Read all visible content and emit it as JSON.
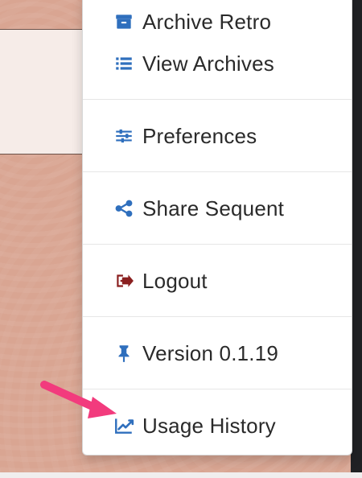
{
  "menu": {
    "items": [
      {
        "label": "Archive Retro",
        "icon": "archive-box-icon",
        "color": "#2f6fbd"
      },
      {
        "label": "View Archives",
        "icon": "list-icon",
        "color": "#2f6fbd"
      },
      {
        "label": "Preferences",
        "icon": "sliders-icon",
        "color": "#2f6fbd"
      },
      {
        "label": "Share Sequent",
        "icon": "share-nodes-icon",
        "color": "#2f6fbd"
      },
      {
        "label": "Logout",
        "icon": "logout-icon",
        "color": "#8a1f1f"
      },
      {
        "label": "Version 0.1.19",
        "icon": "pin-icon",
        "color": "#2f6fbd"
      },
      {
        "label": "Usage History",
        "icon": "line-chart-icon",
        "color": "#2f6fbd"
      }
    ]
  },
  "annotations": {
    "callout_arrow_color": "#f23b7d"
  },
  "theme": {
    "background": "#d9a592",
    "menu_background": "#ffffff",
    "divider": "#e6e6e6"
  }
}
